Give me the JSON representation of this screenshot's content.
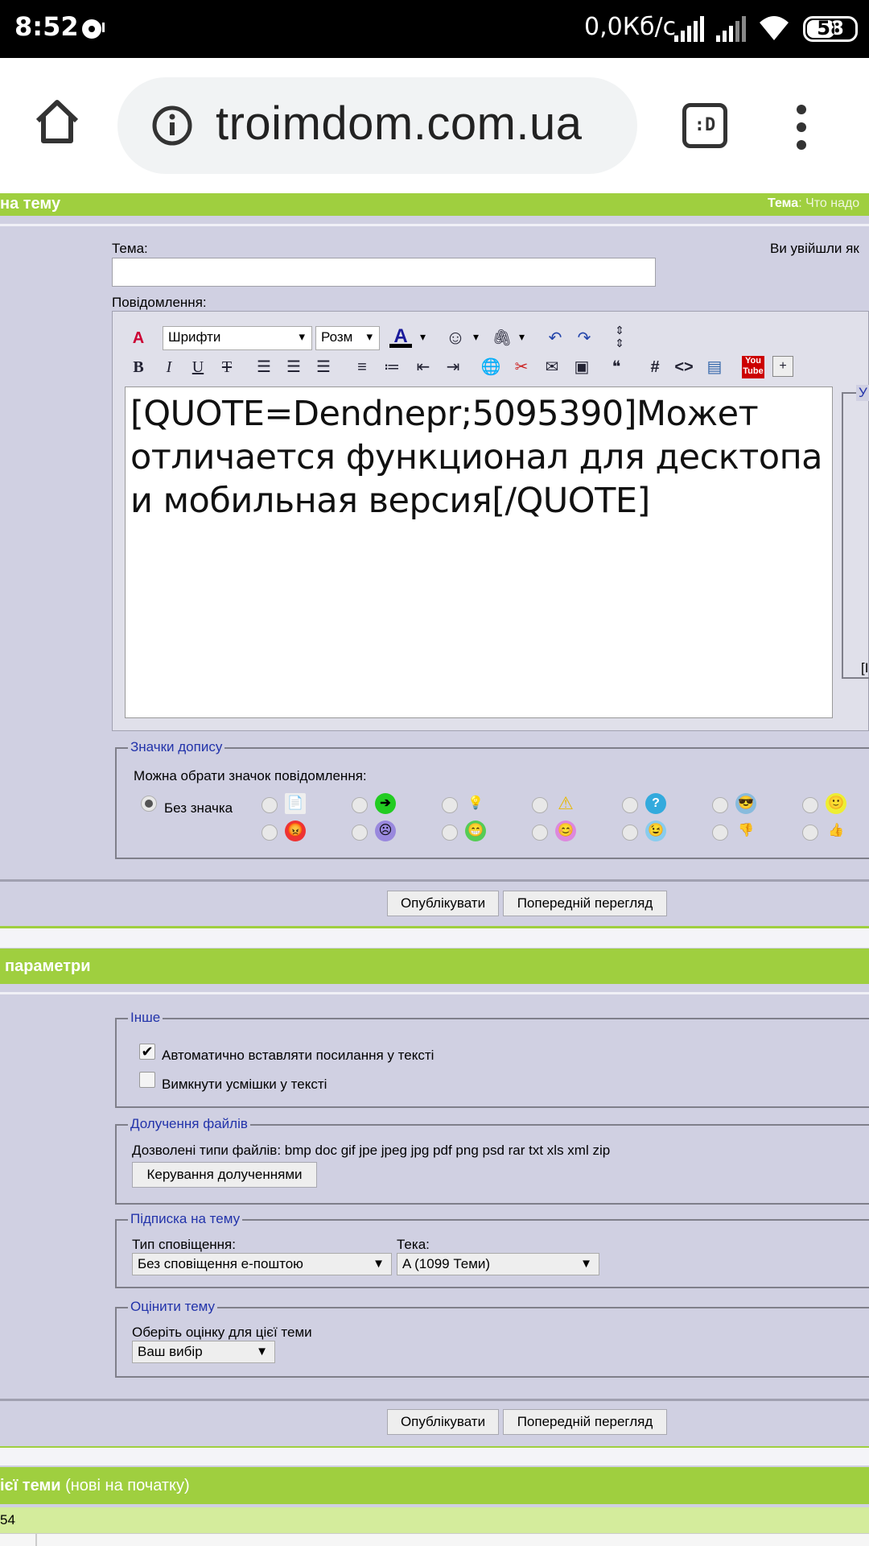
{
  "status": {
    "time": "8:52",
    "speed": "0,0Кб/с",
    "battery": "58"
  },
  "browser": {
    "url": "troimdom.com.ua",
    "tabs_label": ":D"
  },
  "header": {
    "title": "на тему",
    "topic_label": "Тема",
    "topic_value": ": Что надо"
  },
  "form": {
    "subject_label": "Тема:",
    "logged_in": "Ви увійшли як",
    "message_label": "Повідомлення:",
    "font_select": "Шрифти",
    "size_select": "Розм",
    "message_text": "[QUOTE=Dendnepr;5095390]Может отличается функционал для десктопа и мобильная версия[/QUOTE]",
    "side_label": "У",
    "side_bracket": "[I"
  },
  "icons_section": {
    "legend": "Значки допису",
    "hint": "Можна обрати значок повідомлення:",
    "none_label": "Без значка"
  },
  "buttons": {
    "publish": "Опублікувати",
    "preview": "Попередній перегляд"
  },
  "params_header": "параметри",
  "other": {
    "legend": "Інше",
    "auto_links": "Автоматично вставляти посилання у тексті",
    "disable_smilies": "Вимкнути усмішки у тексті"
  },
  "attachments": {
    "legend": "Долучення файлів",
    "types": "Дозволені типи файлів: bmp doc gif jpe jpeg jpg pdf png psd rar txt xls xml zip",
    "manage": "Керування долученнями"
  },
  "subscription": {
    "legend": "Підписка на тему",
    "type_label": "Тип сповіщення:",
    "type_value": "Без сповіщення е-поштою",
    "folder_label": "Тека:",
    "folder_value": "A (1099 Теми)"
  },
  "rating": {
    "legend": "Оцінити тему",
    "label": "Оберіть оцінку для цієї теми",
    "value": "Ваш вибір"
  },
  "bottom": {
    "title_bold": "ієї теми",
    "title_rest": " (нові на початку)",
    "sub": "54"
  },
  "colors": {
    "green": "#9fcf3f",
    "panel": "#d0d0e2",
    "legend": "#2233aa"
  }
}
